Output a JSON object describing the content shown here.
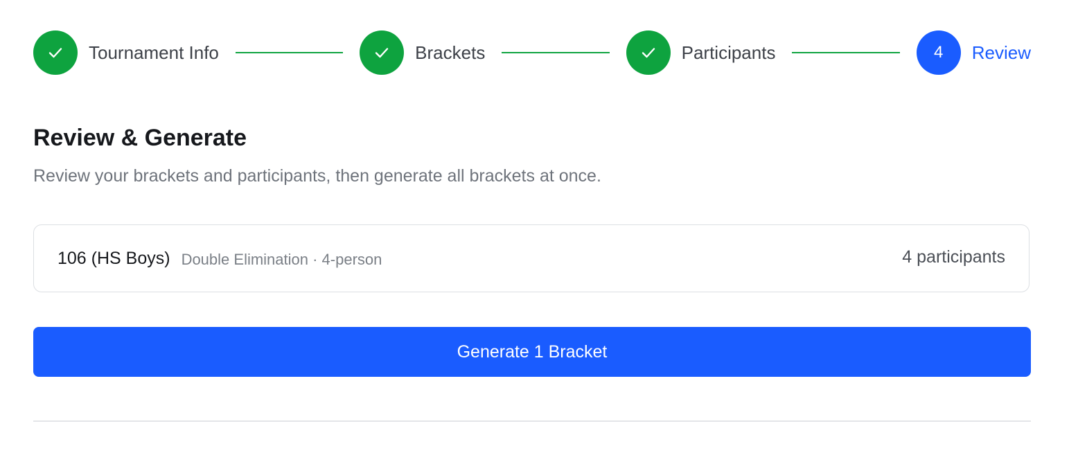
{
  "stepper": {
    "steps": [
      {
        "number": "1",
        "label": "Tournament Info",
        "state": "done",
        "icon": "check-icon"
      },
      {
        "number": "2",
        "label": "Brackets",
        "state": "done",
        "icon": "check-icon"
      },
      {
        "number": "3",
        "label": "Participants",
        "state": "done",
        "icon": "check-icon"
      },
      {
        "number": "4",
        "label": "Review",
        "state": "active"
      }
    ]
  },
  "main": {
    "title": "Review & Generate",
    "subtitle": "Review your brackets and participants, then generate all brackets at once."
  },
  "brackets": [
    {
      "name": "106 (HS Boys)",
      "meta": "Double Elimination · 4-person",
      "participants": "4 participants"
    }
  ],
  "actions": {
    "generate_label": "Generate 1 Bracket"
  },
  "colors": {
    "done": "#0ea33f",
    "active": "#1a5cff",
    "primary_button": "#1a5cff"
  }
}
